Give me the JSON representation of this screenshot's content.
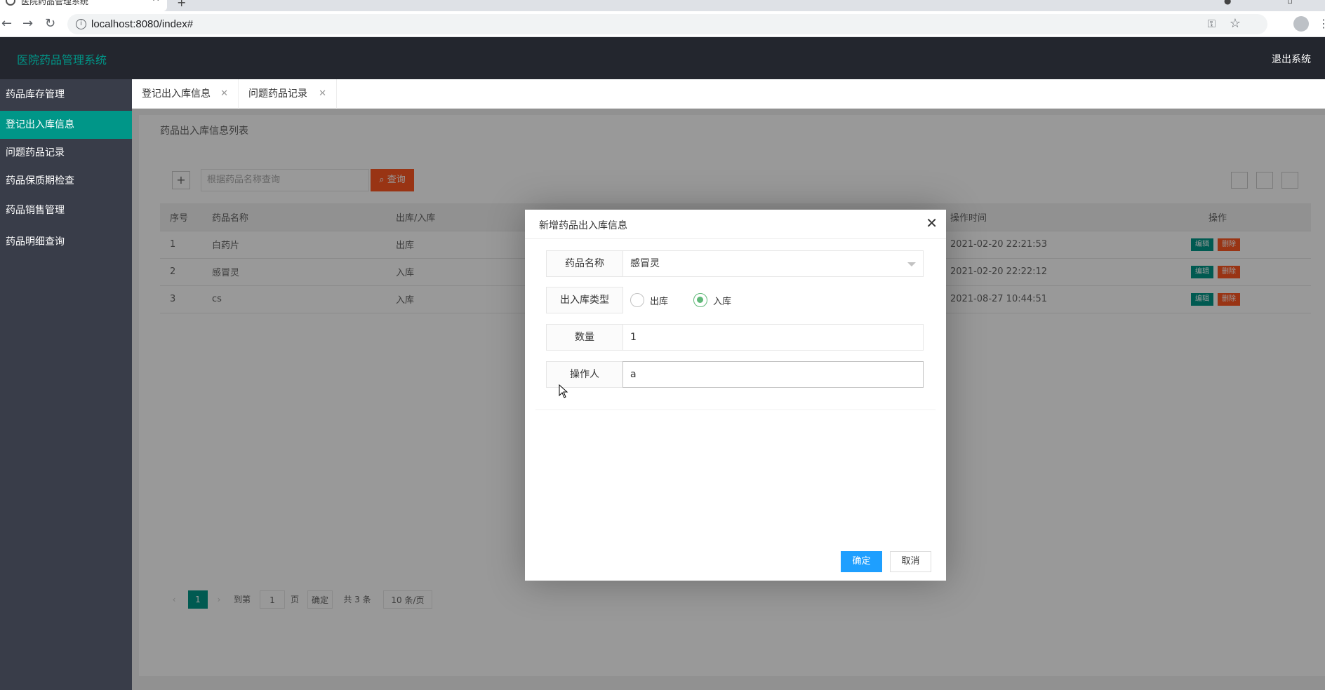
{
  "browser": {
    "tab_title": "医院药品管理系统",
    "url": "localhost:8080/index#"
  },
  "app": {
    "title": "医院药品管理系统",
    "logout": "退出系统"
  },
  "sidebar": {
    "items": [
      {
        "label": "药品库存管理"
      },
      {
        "label": "登记出入库信息"
      },
      {
        "label": "问题药品记录"
      },
      {
        "label": "药品保质期检查"
      },
      {
        "label": "药品销售管理"
      },
      {
        "label": "药品明细查询"
      }
    ]
  },
  "tabs": [
    {
      "label": "登记出入库信息"
    },
    {
      "label": "问题药品记录"
    }
  ],
  "list": {
    "title": "药品出入库信息列表",
    "search_placeholder": "根据药品名称查询",
    "search_button": "查询",
    "columns": [
      "序号",
      "药品名称",
      "出库/入库",
      "操作时间",
      "操作"
    ],
    "rows": [
      {
        "no": "1",
        "name": "白药片",
        "type": "出库",
        "time": "2021-02-20 22:21:53"
      },
      {
        "no": "2",
        "name": "感冒灵",
        "type": "入库",
        "time": "2021-02-20 22:22:12"
      },
      {
        "no": "3",
        "name": "cs",
        "type": "入库",
        "time": "2021-08-27 10:44:51"
      }
    ],
    "edit_label": "编辑",
    "delete_label": "删除"
  },
  "pager": {
    "current": "1",
    "goto": "到第",
    "page_input": "1",
    "page_unit": "页",
    "confirm": "确定",
    "total": "共 3 条",
    "per_page": "10 条/页"
  },
  "modal": {
    "title": "新增药品出入库信息",
    "fields": {
      "name": {
        "label": "药品名称",
        "value": "感冒灵"
      },
      "type": {
        "label": "出入库类型",
        "option_out": "出库",
        "option_in": "入库",
        "selected": "入库"
      },
      "quantity": {
        "label": "数量",
        "value": "1"
      },
      "operator": {
        "label": "操作人",
        "value": "a"
      }
    },
    "ok": "确定",
    "cancel": "取消"
  },
  "colors": {
    "header_bg": "#23262e",
    "sidebar_bg": "#393d49",
    "accent": "#009688",
    "primary_button": "#1e9fff",
    "danger": "#ff5722",
    "radio_checked": "#5fb878"
  }
}
